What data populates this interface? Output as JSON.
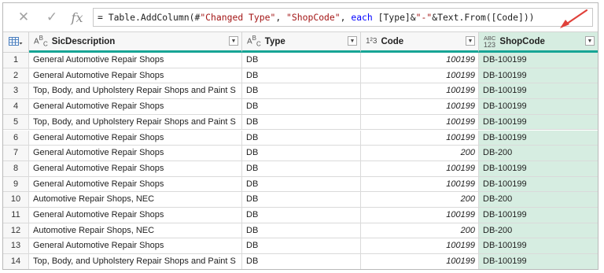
{
  "formula": {
    "cancel_icon": "close-icon",
    "commit_icon": "check-icon",
    "fx_label": "fx",
    "parts": [
      {
        "t": "= Table.AddColumn(#",
        "k": "plain"
      },
      {
        "t": "\"Changed Type\"",
        "k": "str"
      },
      {
        "t": ", ",
        "k": "plain"
      },
      {
        "t": "\"ShopCode\"",
        "k": "str"
      },
      {
        "t": ", ",
        "k": "plain"
      },
      {
        "t": "each",
        "k": "kw"
      },
      {
        "t": " [Type]&",
        "k": "plain"
      },
      {
        "t": "\"-\"",
        "k": "str"
      },
      {
        "t": "&Text.From([Code]))",
        "k": "plain"
      }
    ]
  },
  "colors": {
    "accent": "#17a595",
    "new_column": "#d6ede1",
    "arrow": "#e0413a"
  },
  "columns": [
    {
      "name": "SicDescription",
      "type_icon_top": "A",
      "type_icon_sup": "B",
      "type_icon_sub": "C"
    },
    {
      "name": "Type",
      "type_icon_top": "A",
      "type_icon_sup": "B",
      "type_icon_sub": "C"
    },
    {
      "name": "Code",
      "type_icon": "1²3"
    },
    {
      "name": "ShopCode",
      "type_icon_line1": "ABC",
      "type_icon_line2": "123"
    }
  ],
  "rows": [
    {
      "n": "1",
      "desc": "General Automotive Repair Shops",
      "type": "DB",
      "code": "100199",
      "shop": "DB-100199"
    },
    {
      "n": "2",
      "desc": "General Automotive Repair Shops",
      "type": "DB",
      "code": "100199",
      "shop": "DB-100199"
    },
    {
      "n": "3",
      "desc": "Top, Body, and Upholstery Repair Shops and Paint S",
      "type": "DB",
      "code": "100199",
      "shop": "DB-100199"
    },
    {
      "n": "4",
      "desc": "General Automotive Repair Shops",
      "type": "DB",
      "code": "100199",
      "shop": "DB-100199"
    },
    {
      "n": "5",
      "desc": "Top, Body, and Upholstery Repair Shops and Paint S",
      "type": "DB",
      "code": "100199",
      "shop": "DB-100199"
    },
    {
      "n": "6",
      "desc": "General Automotive Repair Shops",
      "type": "DB",
      "code": "100199",
      "shop": "DB-100199"
    },
    {
      "n": "7",
      "desc": "General Automotive Repair Shops",
      "type": "DB",
      "code": "200",
      "shop": "DB-200"
    },
    {
      "n": "8",
      "desc": "General Automotive Repair Shops",
      "type": "DB",
      "code": "100199",
      "shop": "DB-100199"
    },
    {
      "n": "9",
      "desc": "General Automotive Repair Shops",
      "type": "DB",
      "code": "100199",
      "shop": "DB-100199"
    },
    {
      "n": "10",
      "desc": "Automotive Repair Shops, NEC",
      "type": "DB",
      "code": "200",
      "shop": "DB-200"
    },
    {
      "n": "11",
      "desc": "General Automotive Repair Shops",
      "type": "DB",
      "code": "100199",
      "shop": "DB-100199"
    },
    {
      "n": "12",
      "desc": "Automotive Repair Shops, NEC",
      "type": "DB",
      "code": "200",
      "shop": "DB-200"
    },
    {
      "n": "13",
      "desc": "General Automotive Repair Shops",
      "type": "DB",
      "code": "100199",
      "shop": "DB-100199"
    },
    {
      "n": "14",
      "desc": "Top, Body, and Upholstery Repair Shops and Paint S",
      "type": "DB",
      "code": "100199",
      "shop": "DB-100199"
    }
  ]
}
